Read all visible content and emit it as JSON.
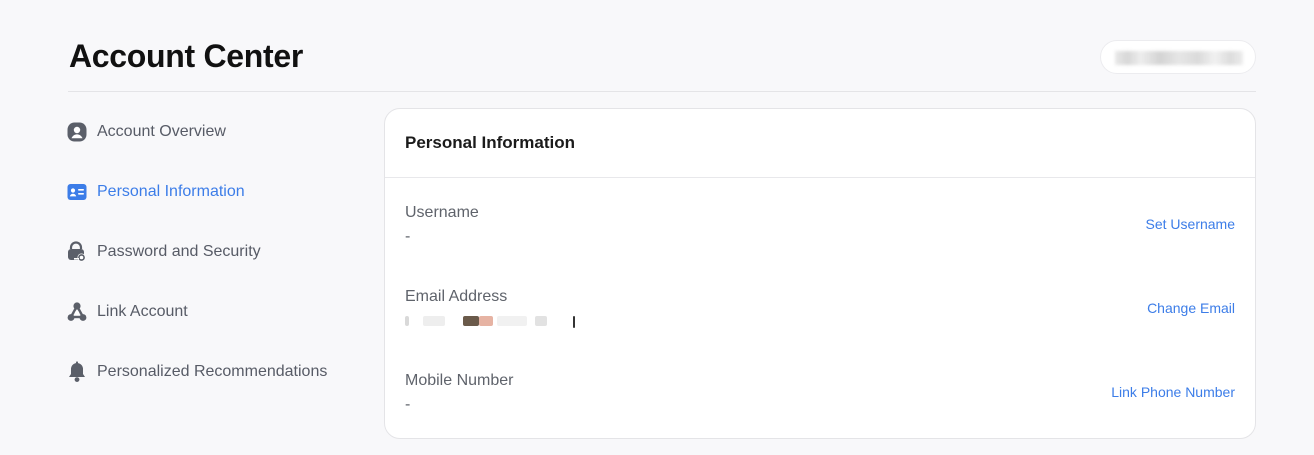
{
  "header": {
    "title": "Account Center",
    "user_chip": "redacted-user"
  },
  "sidebar": {
    "items": [
      {
        "label": "Account Overview",
        "icon": "user-circle-icon",
        "active": false
      },
      {
        "label": "Personal Information",
        "icon": "id-card-icon",
        "active": true
      },
      {
        "label": "Password and Security",
        "icon": "lock-key-icon",
        "active": false
      },
      {
        "label": "Link Account",
        "icon": "link-nodes-icon",
        "active": false
      },
      {
        "label": "Personalized Recommendations",
        "icon": "bell-icon",
        "active": false
      }
    ]
  },
  "main": {
    "title": "Personal Information",
    "fields": [
      {
        "label": "Username",
        "value": "-",
        "action": "Set Username"
      },
      {
        "label": "Email Address",
        "value": "",
        "action": "Change Email",
        "masked": true
      },
      {
        "label": "Mobile Number",
        "value": "-",
        "action": "Link Phone Number"
      }
    ]
  },
  "colors": {
    "accent": "#3c7de8",
    "text_muted": "#575b66",
    "background": "#f8f8fa",
    "card": "#ffffff"
  }
}
